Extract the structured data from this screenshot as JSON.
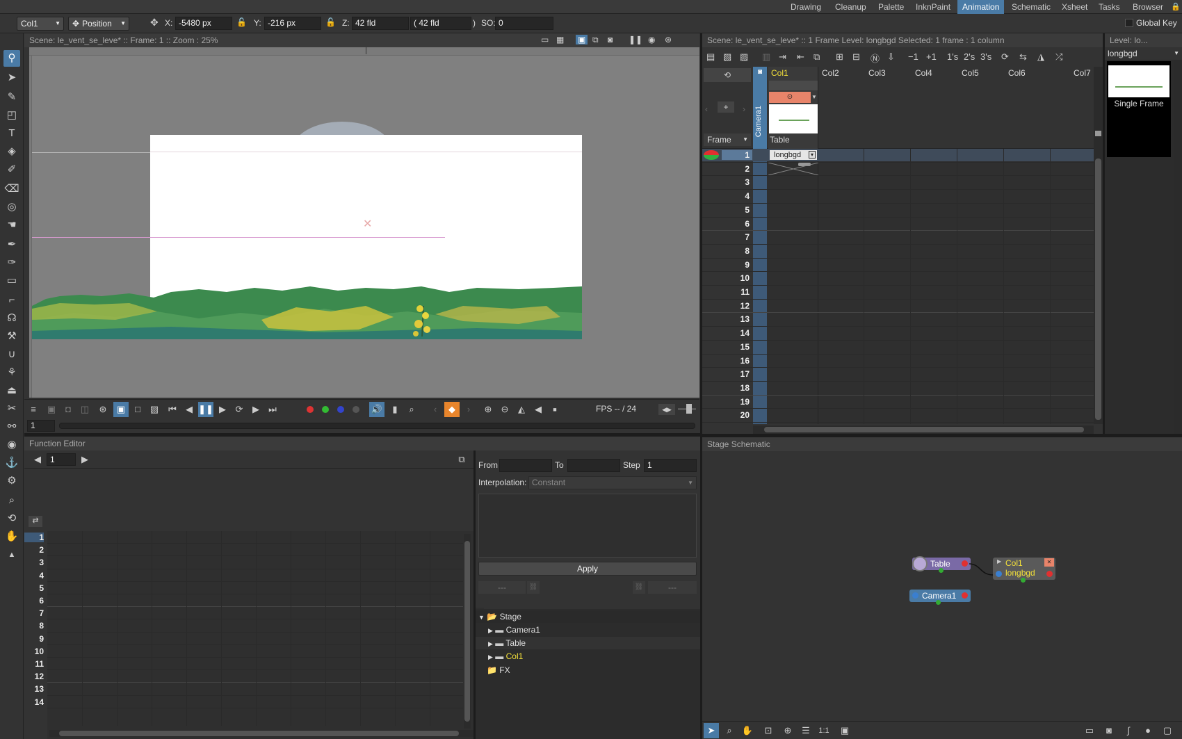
{
  "rooms": [
    "Drawing",
    "Cleanup",
    "Palette",
    "InknPaint",
    "Animation",
    "Schematic",
    "Xsheet",
    "Tasks",
    "Browser"
  ],
  "active_room": "Animation",
  "tool_options": {
    "column_select": "Col1",
    "mode_select": "Position",
    "x_label": "X:",
    "x_value": "-5480 px",
    "y_label": "Y:",
    "y_value": "-216 px",
    "z_label": "Z:",
    "z_value": "42 fld",
    "z_paren_value": "( 42 fld",
    "z_paren_close": ")",
    "so_label": "SO:",
    "so_value": "0",
    "global_key_label": "Global Key"
  },
  "viewer": {
    "header": "Scene: le_vent_se_leve*   ::   Frame: 1   ::   Zoom : 25%",
    "frame_field": "1",
    "fps_label": "FPS -- / 24",
    "accent_color": "#4a7ba6"
  },
  "xsheet": {
    "header": "Scene: le_vent_se_leve*   ::   1 Frame  Level: longbgd   Selected: 1 frame : 1 column",
    "frame_mode": "Frame",
    "camera_column_label": "Camera1",
    "columns": [
      "Col1",
      "Col2",
      "Col3",
      "Col4",
      "Col5",
      "Col6",
      "Col7"
    ],
    "col1_pegbar": "Table",
    "cell_level": "longbgd",
    "rows": [
      "1",
      "2",
      "3",
      "4",
      "5",
      "6",
      "7",
      "8",
      "9",
      "10",
      "11",
      "12",
      "13",
      "14",
      "15",
      "16",
      "17",
      "18",
      "19",
      "20"
    ],
    "toolbar_labels": [
      "−1",
      "+1",
      "1's",
      "2's",
      "3's"
    ]
  },
  "level_strip": {
    "header": "Level:  lo...",
    "level_name": "longbgd",
    "frame_label": "Single Frame"
  },
  "function_editor": {
    "title": "Function Editor",
    "frame_field": "1",
    "rows": [
      "1",
      "2",
      "3",
      "4",
      "5",
      "6",
      "7",
      "8",
      "9",
      "10",
      "11",
      "12",
      "13",
      "14"
    ],
    "from_label": "From",
    "to_label": "To",
    "step_label": "Step",
    "step_value": "1",
    "interpolation_label": "Interpolation:",
    "interpolation_value": "Constant",
    "apply_label": "Apply",
    "dash_left": "---",
    "dash_right": "---",
    "tree": {
      "stage": "Stage",
      "camera": "Camera1",
      "table": "Table",
      "col": "Col1",
      "fx": "FX"
    }
  },
  "schematic": {
    "title": "Stage Schematic",
    "table_node": "Table",
    "col_node_name": "Col1",
    "col_node_level": "longbgd",
    "camera_node": "Camera1",
    "zoom_label": "1:1"
  }
}
